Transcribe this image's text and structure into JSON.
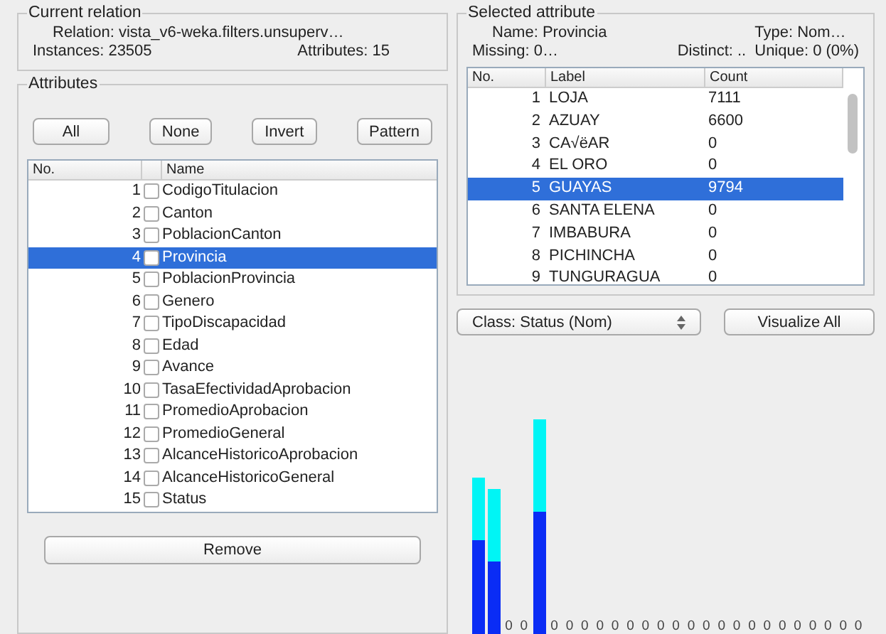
{
  "current_relation": {
    "title": "Current relation",
    "relation": "Relation: vista_v6-weka.filters.unsuperv…",
    "instances": "Instances: 23505",
    "attributes": "Attributes: 15"
  },
  "attributes": {
    "title": "Attributes",
    "buttons": [
      "All",
      "None",
      "Invert",
      "Pattern"
    ],
    "columns": [
      "No.",
      "Name"
    ],
    "rows": [
      {
        "no": "1",
        "name": "CodigoTitulacion",
        "checked": false,
        "selected": false
      },
      {
        "no": "2",
        "name": "Canton",
        "checked": false,
        "selected": false
      },
      {
        "no": "3",
        "name": "PoblacionCanton",
        "checked": false,
        "selected": false
      },
      {
        "no": "4",
        "name": "Provincia",
        "checked": false,
        "selected": true
      },
      {
        "no": "5",
        "name": "PoblacionProvincia",
        "checked": false,
        "selected": false
      },
      {
        "no": "6",
        "name": "Genero",
        "checked": false,
        "selected": false
      },
      {
        "no": "7",
        "name": "TipoDiscapacidad",
        "checked": false,
        "selected": false
      },
      {
        "no": "8",
        "name": "Edad",
        "checked": false,
        "selected": false
      },
      {
        "no": "9",
        "name": "Avance",
        "checked": false,
        "selected": false
      },
      {
        "no": "10",
        "name": "TasaEfectividadAprobacion",
        "checked": false,
        "selected": false
      },
      {
        "no": "11",
        "name": "PromedioAprobacion",
        "checked": false,
        "selected": false
      },
      {
        "no": "12",
        "name": "PromedioGeneral",
        "checked": false,
        "selected": false
      },
      {
        "no": "13",
        "name": "AlcanceHistoricoAprobacion",
        "checked": false,
        "selected": false
      },
      {
        "no": "14",
        "name": "AlcanceHistoricoGeneral",
        "checked": false,
        "selected": false
      },
      {
        "no": "15",
        "name": "Status",
        "checked": false,
        "selected": false
      }
    ],
    "remove_button": "Remove"
  },
  "selected_attribute": {
    "title": "Selected attribute",
    "name": "Name: Provincia",
    "type": "Type: Nom…",
    "missing": "Missing: 0…",
    "distinct": "Distinct: ..",
    "unique": "Unique: 0 (0%)",
    "columns": [
      "No.",
      "Label",
      "Count"
    ],
    "rows": [
      {
        "no": "1",
        "label": "LOJA",
        "count": "7111",
        "selected": false
      },
      {
        "no": "2",
        "label": "AZUAY",
        "count": "6600",
        "selected": false
      },
      {
        "no": "3",
        "label": "CA√ëAR",
        "count": "0",
        "selected": false
      },
      {
        "no": "4",
        "label": "EL ORO",
        "count": "0",
        "selected": false
      },
      {
        "no": "5",
        "label": "GUAYAS",
        "count": "9794",
        "selected": true
      },
      {
        "no": "6",
        "label": "SANTA ELENA",
        "count": "0",
        "selected": false
      },
      {
        "no": "7",
        "label": "IMBABURA",
        "count": "0",
        "selected": false
      },
      {
        "no": "8",
        "label": "PICHINCHA",
        "count": "0",
        "selected": false
      },
      {
        "no": "9",
        "label": "TUNGURAGUA",
        "count": "0",
        "selected": false
      }
    ]
  },
  "class_select": "Class: Status (Nom)",
  "visualize_button": "Visualize All",
  "histogram": {
    "bins": [
      {
        "kind": "bar"
      },
      {
        "kind": "bar"
      },
      {
        "kind": "zero",
        "label": "0"
      },
      {
        "kind": "zero",
        "label": "0"
      },
      {
        "kind": "bar"
      },
      {
        "kind": "zero",
        "label": "0"
      },
      {
        "kind": "zero",
        "label": "0"
      },
      {
        "kind": "zero",
        "label": "0"
      },
      {
        "kind": "zero",
        "label": "0"
      },
      {
        "kind": "zero",
        "label": "0"
      },
      {
        "kind": "zero",
        "label": "0"
      },
      {
        "kind": "zero",
        "label": "0"
      },
      {
        "kind": "zero",
        "label": "0"
      },
      {
        "kind": "zero",
        "label": "0"
      },
      {
        "kind": "zero",
        "label": "0"
      },
      {
        "kind": "zero",
        "label": "0"
      },
      {
        "kind": "zero",
        "label": "0"
      },
      {
        "kind": "zero",
        "label": "0"
      },
      {
        "kind": "zero",
        "label": "0"
      },
      {
        "kind": "zero",
        "label": "0"
      },
      {
        "kind": "zero",
        "label": "0"
      },
      {
        "kind": "zero",
        "label": "0"
      },
      {
        "kind": "zero",
        "label": "0"
      },
      {
        "kind": "zero",
        "label": "0"
      },
      {
        "kind": "zero",
        "label": "0"
      },
      {
        "kind": "zero",
        "label": "0"
      }
    ]
  }
}
